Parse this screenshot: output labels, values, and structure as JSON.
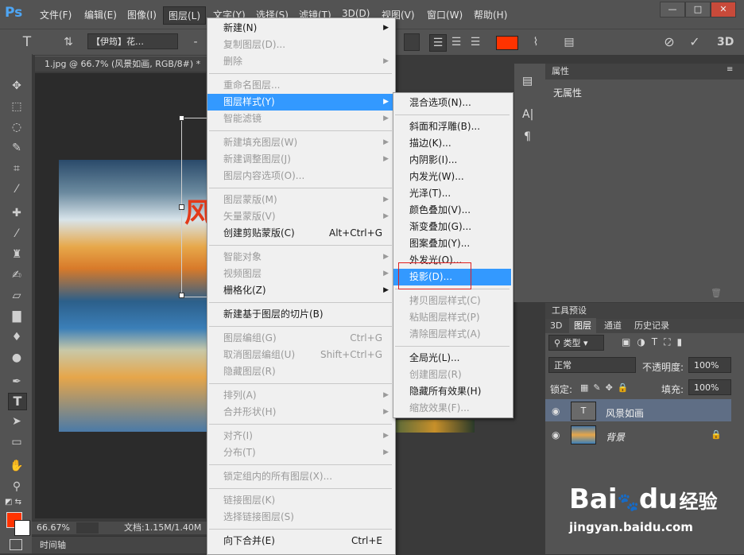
{
  "app": {
    "logo": "Ps"
  },
  "menubar": {
    "items": [
      "文件(F)",
      "编辑(E)",
      "图像(I)",
      "图层(L)",
      "文字(Y)",
      "选择(S)",
      "滤镜(T)",
      "3D(D)",
      "视图(V)",
      "窗口(W)",
      "帮助(H)"
    ],
    "window_buttons": [
      "—",
      "□",
      "✕"
    ]
  },
  "options": {
    "tool_label": "T",
    "font_family": "【伊筠】花…",
    "dash": "-",
    "three_d": "3D",
    "text_color": "#ff3300"
  },
  "document": {
    "tab_title": "1.jpg @ 66.7% (风景如画, RGB/8#) *",
    "zoom": "66.67%",
    "doc_size": "文档:1.15M/1.40M",
    "glyph": "风"
  },
  "timeline": {
    "label": "时间轴"
  },
  "layer_menu": {
    "items": [
      {
        "label": "新建(N)",
        "shortcut": "",
        "submenu": true,
        "disabled": false
      },
      {
        "label": "复制图层(D)...",
        "shortcut": "",
        "submenu": false,
        "disabled": true
      },
      {
        "label": "删除",
        "shortcut": "",
        "submenu": true,
        "disabled": true
      },
      {
        "label": "重命名图层...",
        "shortcut": "",
        "submenu": false,
        "disabled": true
      },
      {
        "label": "图层样式(Y)",
        "shortcut": "",
        "submenu": true,
        "disabled": false,
        "highlighted": true
      },
      {
        "label": "智能滤镜",
        "shortcut": "",
        "submenu": true,
        "disabled": true
      },
      {
        "label": "新建填充图层(W)",
        "shortcut": "",
        "submenu": true,
        "disabled": true
      },
      {
        "label": "新建调整图层(J)",
        "shortcut": "",
        "submenu": true,
        "disabled": true
      },
      {
        "label": "图层内容选项(O)...",
        "shortcut": "",
        "submenu": false,
        "disabled": true
      },
      {
        "label": "图层蒙版(M)",
        "shortcut": "",
        "submenu": true,
        "disabled": true
      },
      {
        "label": "矢量蒙版(V)",
        "shortcut": "",
        "submenu": true,
        "disabled": true
      },
      {
        "label": "创建剪贴蒙版(C)",
        "shortcut": "Alt+Ctrl+G",
        "submenu": false,
        "disabled": false
      },
      {
        "label": "智能对象",
        "shortcut": "",
        "submenu": true,
        "disabled": true
      },
      {
        "label": "视频图层",
        "shortcut": "",
        "submenu": true,
        "disabled": true
      },
      {
        "label": "栅格化(Z)",
        "shortcut": "",
        "submenu": true,
        "disabled": false
      },
      {
        "label": "新建基于图层的切片(B)",
        "shortcut": "",
        "submenu": false,
        "disabled": false
      },
      {
        "label": "图层编组(G)",
        "shortcut": "Ctrl+G",
        "submenu": false,
        "disabled": true
      },
      {
        "label": "取消图层编组(U)",
        "shortcut": "Shift+Ctrl+G",
        "submenu": false,
        "disabled": true
      },
      {
        "label": "隐藏图层(R)",
        "shortcut": "",
        "submenu": false,
        "disabled": true
      },
      {
        "label": "排列(A)",
        "shortcut": "",
        "submenu": true,
        "disabled": true
      },
      {
        "label": "合并形状(H)",
        "shortcut": "",
        "submenu": true,
        "disabled": true
      },
      {
        "label": "对齐(I)",
        "shortcut": "",
        "submenu": true,
        "disabled": true
      },
      {
        "label": "分布(T)",
        "shortcut": "",
        "submenu": true,
        "disabled": true
      },
      {
        "label": "锁定组内的所有图层(X)...",
        "shortcut": "",
        "submenu": false,
        "disabled": true
      },
      {
        "label": "链接图层(K)",
        "shortcut": "",
        "submenu": false,
        "disabled": true
      },
      {
        "label": "选择链接图层(S)",
        "shortcut": "",
        "submenu": false,
        "disabled": true
      },
      {
        "label": "向下合并(E)",
        "shortcut": "Ctrl+E",
        "submenu": false,
        "disabled": false
      }
    ]
  },
  "style_menu": {
    "items": [
      {
        "label": "混合选项(N)...",
        "disabled": false
      },
      {
        "label": "斜面和浮雕(B)...",
        "disabled": false
      },
      {
        "label": "描边(K)...",
        "disabled": false
      },
      {
        "label": "内阴影(I)...",
        "disabled": false
      },
      {
        "label": "内发光(W)...",
        "disabled": false
      },
      {
        "label": "光泽(T)...",
        "disabled": false
      },
      {
        "label": "颜色叠加(V)...",
        "disabled": false
      },
      {
        "label": "渐变叠加(G)...",
        "disabled": false
      },
      {
        "label": "图案叠加(Y)...",
        "disabled": false
      },
      {
        "label": "外发光(O)...",
        "disabled": false
      },
      {
        "label": "投影(D)...",
        "disabled": false,
        "highlighted": true
      },
      {
        "label": "拷贝图层样式(C)",
        "disabled": true
      },
      {
        "label": "粘贴图层样式(P)",
        "disabled": true
      },
      {
        "label": "清除图层样式(A)",
        "disabled": true
      },
      {
        "label": "全局光(L)...",
        "disabled": false
      },
      {
        "label": "创建图层(R)",
        "disabled": true
      },
      {
        "label": "隐藏所有效果(H)",
        "disabled": false
      },
      {
        "label": "缩放效果(F)...",
        "disabled": true
      }
    ]
  },
  "properties": {
    "tab": "属性",
    "empty": "无属性"
  },
  "tool_presets": {
    "tab": "工具预设"
  },
  "layers_panel": {
    "tabs": [
      "3D",
      "图层",
      "通道",
      "历史记录"
    ],
    "filter": "类型",
    "blend_mode": "正常",
    "opacity_label": "不透明度:",
    "opacity": "100%",
    "lock_label": "锁定:",
    "fill_label": "填充:",
    "fill": "100%",
    "layers": [
      {
        "name": "风景如画",
        "type": "text"
      },
      {
        "name": "背景",
        "type": "image"
      }
    ]
  },
  "watermark": {
    "brand": "Bai",
    "brand2": "du",
    "suffix": "经验",
    "url": "jingyan.baidu.com"
  },
  "colors": {
    "accent": "#3399ff",
    "fg": "#ff3300",
    "menu_bg": "#f0f0f0",
    "panel": "#535353"
  }
}
